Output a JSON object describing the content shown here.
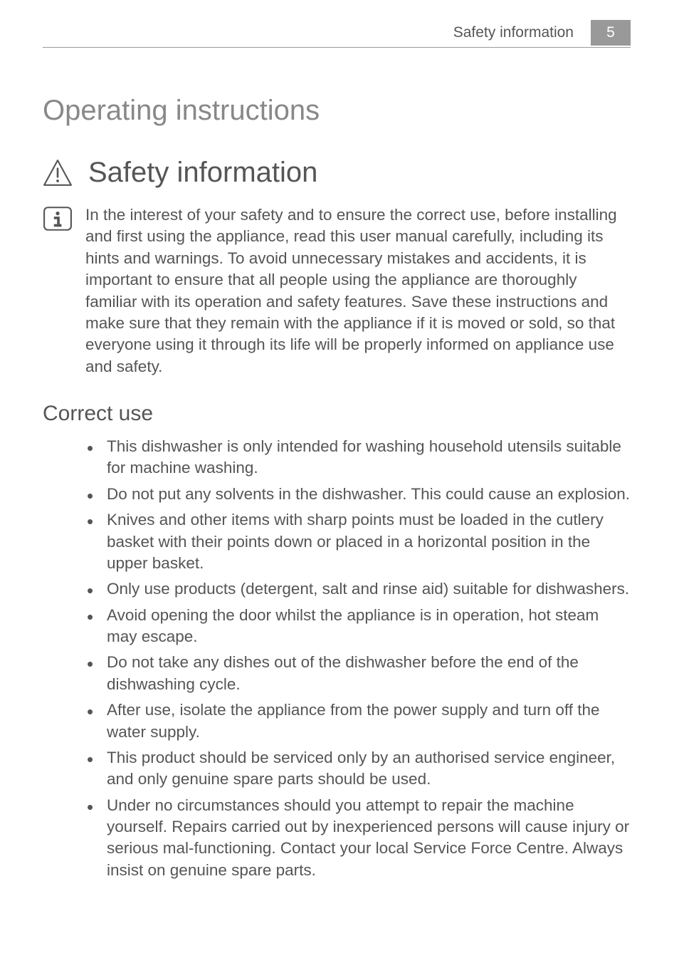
{
  "header": {
    "label": "Safety information",
    "page_number": "5"
  },
  "chapter_title": "Operating instructions",
  "section_title": "Safety information",
  "intro_paragraph": "In the interest of your safety and to ensure the correct use, before installing and first using the appliance, read this user manual carefully, including its hints and warnings. To avoid unnecessary mistakes and accidents, it is important to ensure that all people using the appliance are thoroughly familiar with its operation and safety features. Save these instructions and make sure that they remain with the appliance if it is moved or sold, so that everyone using it through its life will be properly informed on appliance use and safety.",
  "subsection_title": "Correct use",
  "bullets": {
    "0": "This dishwasher is only intended for washing household utensils suitable for machine washing.",
    "1": "Do not put any solvents in the dishwasher. This could cause an explosion.",
    "2": "Knives and other items with sharp points must be loaded in the cutlery basket with their points down or placed in a horizontal position in the upper basket.",
    "3": "Only use products (detergent, salt and rinse aid) suitable for dishwashers.",
    "4": "Avoid opening the door whilst the appliance is in operation, hot steam may escape.",
    "5": "Do not take any dishes out of the dishwasher before the end of the dishwashing cycle.",
    "6": "After use, isolate the appliance from the power supply and turn off the water supply.",
    "7": "This product should be serviced only by an authorised service engineer, and only genuine spare parts should be used.",
    "8": "Under no circumstances should you attempt to repair the machine yourself. Repairs carried out by inexperienced persons will cause injury or serious mal-functioning. Contact your local Service Force Centre. Always insist on genuine spare parts."
  }
}
